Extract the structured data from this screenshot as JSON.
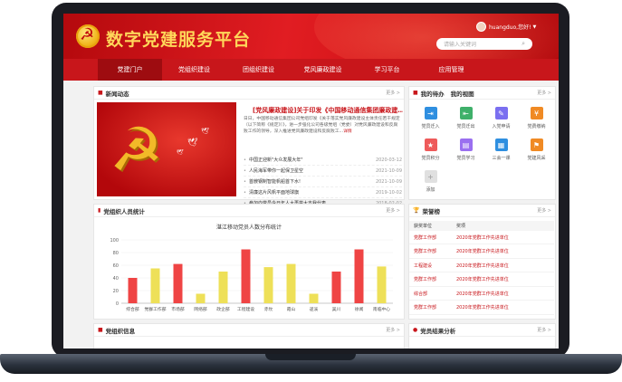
{
  "header": {
    "title": "数字党建服务平台",
    "user": "huangduo,您好!",
    "search_placeholder": "请输入关键词"
  },
  "nav": [
    "党建门户",
    "党组织建设",
    "团组织建设",
    "党风廉政建设",
    "学习平台",
    "应用管理"
  ],
  "news": {
    "title": "新闻动态",
    "more": "更多 >",
    "headline": "[党风廉政建设]关于印发《中国移动通信集团廉政建…",
    "summary": "日日，中国移动通信集团公司党组印发《关于落实党风廉政建设主体责任若干规定（以下简称《规定》）》，进一步强化公司各级党组（党委）对党风廉政建设和反腐败工作的领导，深入推进党风廉政建设和反腐败工...",
    "detail": "详情",
    "items": [
      {
        "t": "中国正迎新\"大众发展大年\"",
        "d": "2020-03-12"
      },
      {
        "t": "人民海军带你一起保卫星空",
        "d": "2021-10-09"
      },
      {
        "t": "首艘钢制智能帆船首下水!",
        "d": "2021-10-09"
      },
      {
        "t": "清廉这片风帆平面地球旗",
        "d": "2019-10-02"
      },
      {
        "t": "参加向党员今日年人大再学大支我代表",
        "d": "2018-02-02"
      }
    ]
  },
  "todo": {
    "title": "我的待办",
    "title2": "我的视图",
    "more": "更多 >",
    "tiles": [
      {
        "l": "党员迁入",
        "c": "#2f8fe0",
        "i": "⇥"
      },
      {
        "l": "党员迁出",
        "c": "#3fb06a",
        "i": "⇤"
      },
      {
        "l": "入党申请",
        "c": "#7a6ff0",
        "i": "✎"
      },
      {
        "l": "党费缴纳",
        "c": "#f08a24",
        "i": "¥"
      },
      {
        "l": "党员积分",
        "c": "#ee5a5a",
        "i": "★"
      },
      {
        "l": "党员学习",
        "c": "#9a6ff0",
        "i": "▤"
      },
      {
        "l": "三会一课",
        "c": "#2f8fe0",
        "i": "▦"
      },
      {
        "l": "党建风采",
        "c": "#f08a24",
        "i": "⚑"
      },
      {
        "l": "添加",
        "c": "#e0e0e0",
        "i": "+"
      }
    ]
  },
  "stats": {
    "title": "党组织人员统计",
    "more": "更多 >"
  },
  "chart_data": {
    "type": "bar",
    "title": "湛江移动党员人数分布统计",
    "categories": [
      "综合部",
      "党群工作部",
      "市场部",
      "网络部",
      "政企部",
      "工程建设",
      "赤坎",
      "霞山",
      "遂溪",
      "吴川",
      "徐闻",
      "南临中心"
    ],
    "values": [
      40,
      55,
      62,
      15,
      50,
      85,
      57,
      62,
      15,
      50,
      85,
      58
    ],
    "colors": [
      "#ef4444",
      "#eee058",
      "#ef4444",
      "#eee058",
      "#eee058",
      "#ef4444",
      "#eee058",
      "#eee058",
      "#eee058",
      "#ef4444",
      "#ef4444",
      "#eee058"
    ],
    "yticks": [
      0,
      20,
      40,
      60,
      80,
      100
    ],
    "ylim": [
      0,
      100
    ]
  },
  "honor": {
    "title": "荣誉榜",
    "more": "更多 >",
    "col1": "获奖单位",
    "col2": "奖项",
    "rows": [
      {
        "u": "党群工作部",
        "a": "2020年党群工作先进单位"
      },
      {
        "u": "党群工作部",
        "a": "2020年党群工作先进单位"
      },
      {
        "u": "工程建设",
        "a": "2020年党群工作先进单位"
      },
      {
        "u": "党群工作部",
        "a": "2020年党群工作先进单位"
      },
      {
        "u": "综合部",
        "a": "2020年党群工作先进单位"
      },
      {
        "u": "党群工作部",
        "a": "2020年党群工作先进单位"
      }
    ]
  },
  "org": {
    "title": "党组织信息",
    "more": "更多 >"
  },
  "analysis": {
    "title": "党员结果分析",
    "more": "更多 >"
  }
}
